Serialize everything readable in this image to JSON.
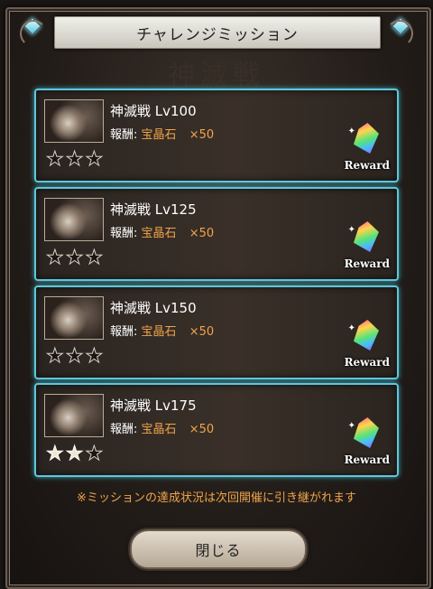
{
  "header": {
    "title": "チャレンジミッション",
    "background_title": "神滅戦"
  },
  "missions": [
    {
      "name": "神滅戦 Lv100",
      "reward_label": "報酬:",
      "reward_item": "宝晶石",
      "reward_count": "×50",
      "stars_earned": 0,
      "stars_total": 3,
      "badge": "Reward"
    },
    {
      "name": "神滅戦 Lv125",
      "reward_label": "報酬:",
      "reward_item": "宝晶石",
      "reward_count": "×50",
      "stars_earned": 0,
      "stars_total": 3,
      "badge": "Reward"
    },
    {
      "name": "神滅戦 Lv150",
      "reward_label": "報酬:",
      "reward_item": "宝晶石",
      "reward_count": "×50",
      "stars_earned": 0,
      "stars_total": 3,
      "badge": "Reward"
    },
    {
      "name": "神滅戦 Lv175",
      "reward_label": "報酬:",
      "reward_item": "宝晶石",
      "reward_count": "×50",
      "stars_earned": 2,
      "stars_total": 3,
      "badge": "Reward"
    }
  ],
  "note": "※ミッションの達成状況は次回開催に引き継がれます",
  "close_button": {
    "label": "閉じる"
  },
  "colors": {
    "accent_border": "#5fc7d9",
    "reward_text": "#f0a44a",
    "title_bar": "#e0ddd5"
  }
}
